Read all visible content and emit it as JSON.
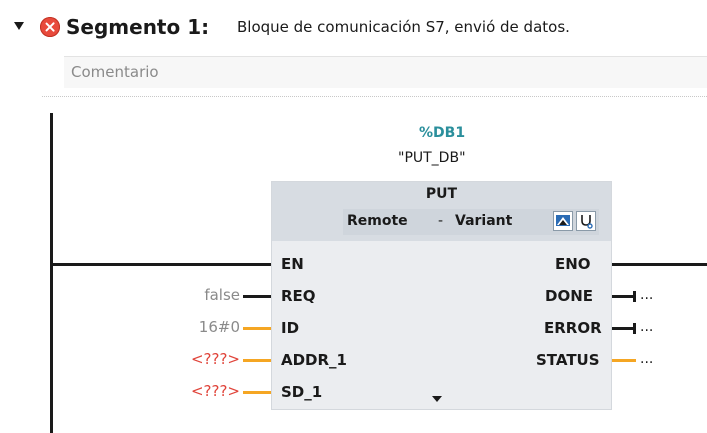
{
  "segment": {
    "title": "Segmento 1:",
    "description": "Bloque de comunicación S7, envió de datos.",
    "comment_placeholder": "Comentario"
  },
  "instance": {
    "db": "%DB1",
    "symbol": "\"PUT_DB\""
  },
  "block": {
    "name": "PUT",
    "mode_left": "Remote",
    "mode_sep": "-",
    "mode_right": "Variant",
    "inputs": [
      {
        "param": "EN",
        "value": ""
      },
      {
        "param": "REQ",
        "value": "false"
      },
      {
        "param": "ID",
        "value": "16#0"
      },
      {
        "param": "ADDR_1",
        "value": "<???>"
      },
      {
        "param": "SD_1",
        "value": "<???>"
      }
    ],
    "outputs": [
      {
        "param": "ENO",
        "value": ""
      },
      {
        "param": "DONE",
        "value": "..."
      },
      {
        "param": "ERROR",
        "value": "..."
      },
      {
        "param": "STATUS",
        "value": "..."
      }
    ]
  },
  "colors": {
    "bool_wire": "#1a1a1a",
    "word_wire": "#f5a623",
    "error_icon": "#e84a3c",
    "db_text": "#2b8f9c",
    "missing_value": "#e0443a"
  },
  "icons": [
    "chevron-down-icon",
    "error-icon",
    "connection-icon",
    "diagnostics-icon",
    "expand-arrow-icon"
  ]
}
